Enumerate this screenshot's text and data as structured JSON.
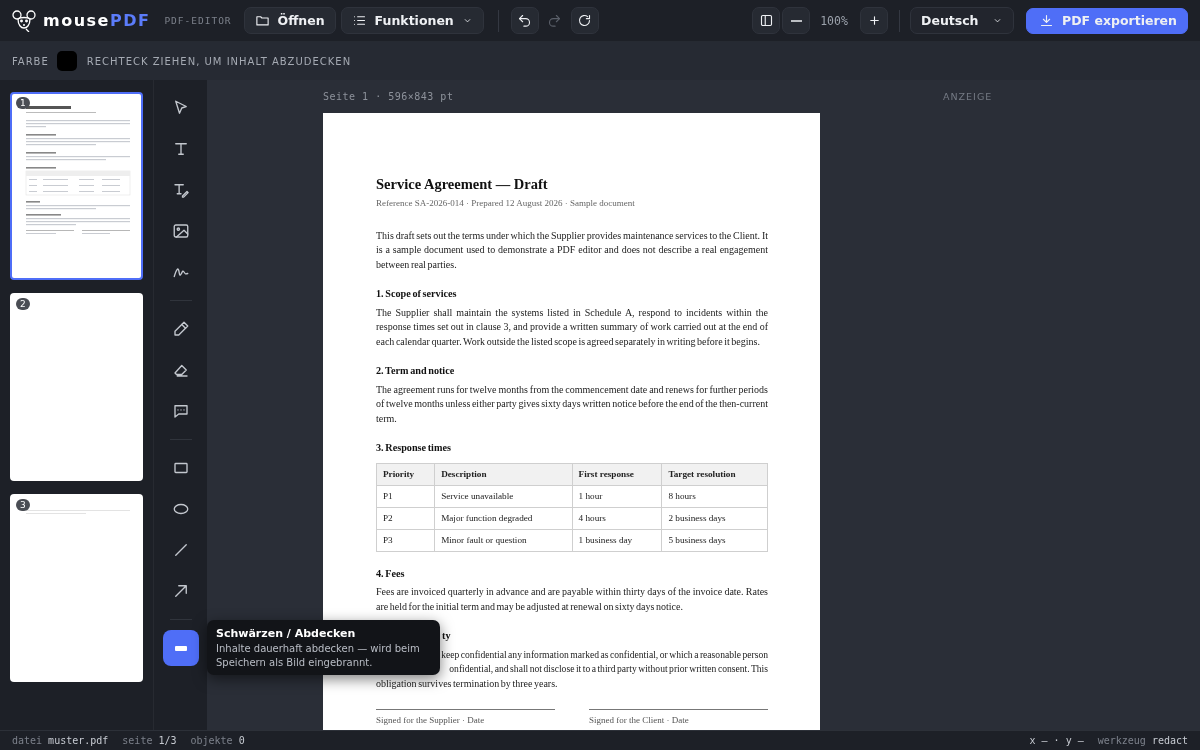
{
  "app": {
    "logo": {
      "name": "mouse",
      "accent": "PDF"
    },
    "subtitle": "PDF-EDITOR"
  },
  "topbar": {
    "left_buttons": [
      {
        "label": "Öffnen",
        "kind": "open"
      },
      {
        "label": "Funktionen",
        "kind": "menu"
      }
    ],
    "history": [
      {
        "kind": "undo",
        "disabled": false
      },
      {
        "kind": "redo",
        "disabled": true
      },
      {
        "kind": "reload",
        "disabled": false
      }
    ],
    "zoom": "100%",
    "language": "Deutsch",
    "export": "PDF exportieren"
  },
  "toolbar": {
    "color_label": "FARBE",
    "color": "#000000",
    "hint": "RECHTECK ZIEHEN, UM INHALT ABZUDECKEN"
  },
  "pages": [
    {
      "number": "1",
      "selected": true,
      "kind": "full"
    },
    {
      "number": "2",
      "selected": false,
      "kind": "blank"
    },
    {
      "number": "3",
      "selected": false,
      "kind": "short"
    }
  ],
  "tool_groups": [
    [
      {
        "kind": "select",
        "selected": false
      },
      {
        "kind": "text",
        "selected": false
      },
      {
        "kind": "text-edit",
        "selected": false
      },
      {
        "kind": "image",
        "selected": false
      },
      {
        "kind": "signature",
        "selected": false
      }
    ],
    [
      {
        "kind": "pen",
        "selected": false
      },
      {
        "kind": "eraser",
        "selected": false
      },
      {
        "kind": "comment",
        "selected": false
      }
    ],
    [
      {
        "kind": "rect",
        "selected": false
      },
      {
        "kind": "ellipse",
        "selected": false
      },
      {
        "kind": "line",
        "selected": false
      },
      {
        "kind": "arrow",
        "selected": false
      }
    ],
    [
      {
        "kind": "redact",
        "selected": true
      }
    ]
  ],
  "tooltip": {
    "title": "Schwärzen / Abdecken",
    "text": "Inhalte dauerhaft abdecken — wird beim Speichern als Bild eingebrannt."
  },
  "canvas": {
    "page_label": "Seite 1 · 596×843 pt",
    "side_label": "ANZEIGE"
  },
  "document": {
    "title": "Service Agreement — Draft",
    "meta": "Reference SA-2026-014 · Prepared 12 August 2026 · Sample document",
    "intro": "This draft sets out the terms under which the Supplier provides maintenance services to the Client. It is a sample document used to demonstrate a PDF editor and does not describe a real engagement between real parties.",
    "sections": [
      {
        "kind": "text",
        "heading": "1. Scope of services",
        "text": "The Supplier shall maintain the systems listed in Schedule A, respond to incidents within the response times set out in clause 3, and provide a written summary of work carried out at the end of each calendar quarter. Work outside the listed scope is agreed separately in writing before it begins."
      },
      {
        "kind": "text",
        "heading": "2. Term and notice",
        "text": "The agreement runs for twelve months from the commencement date and renews for further periods of twelve months unless either party gives sixty days written notice before the end of the then-current term."
      },
      {
        "kind": "table",
        "heading": "3. Response times",
        "columns": [
          "Priority",
          "Description",
          "First response",
          "Target resolution"
        ],
        "rows": [
          [
            "P1",
            "Service unavailable",
            "1 hour",
            "8 hours"
          ],
          [
            "P2",
            "Major function degraded",
            "4 hours",
            "2 business days"
          ],
          [
            "P3",
            "Minor fault or question",
            "1 business day",
            "5 business days"
          ]
        ]
      },
      {
        "kind": "text",
        "heading": "4. Fees",
        "text": "Fees are invoiced quarterly in advance and are payable within thirty days of the invoice date. Rates are held for the initial term and may be adjusted at renewal on sixty days notice."
      },
      {
        "kind": "covered",
        "heading": "ty",
        "lines": [
          {
            "text": "keep confidential any information marked as confidential, or which a reasonable person",
            "covered": true
          },
          {
            "text": "onfidential, and shall not disclose it to a third party without prior written consent. This",
            "covered": true
          },
          {
            "text": "obligation survives termination by three years.",
            "covered": false
          }
        ]
      }
    ],
    "signatures": [
      "Signed for the Supplier · Date",
      "Signed for the Client · Date"
    ]
  },
  "status_bar": {
    "left": [
      {
        "label": "datei",
        "value": "muster.pdf"
      },
      {
        "label": "seite",
        "value": "1/3"
      },
      {
        "label": "objekte",
        "value": "0"
      }
    ],
    "coords": "x — · y —",
    "tool_label": "werkzeug",
    "tool_value": "redact"
  }
}
